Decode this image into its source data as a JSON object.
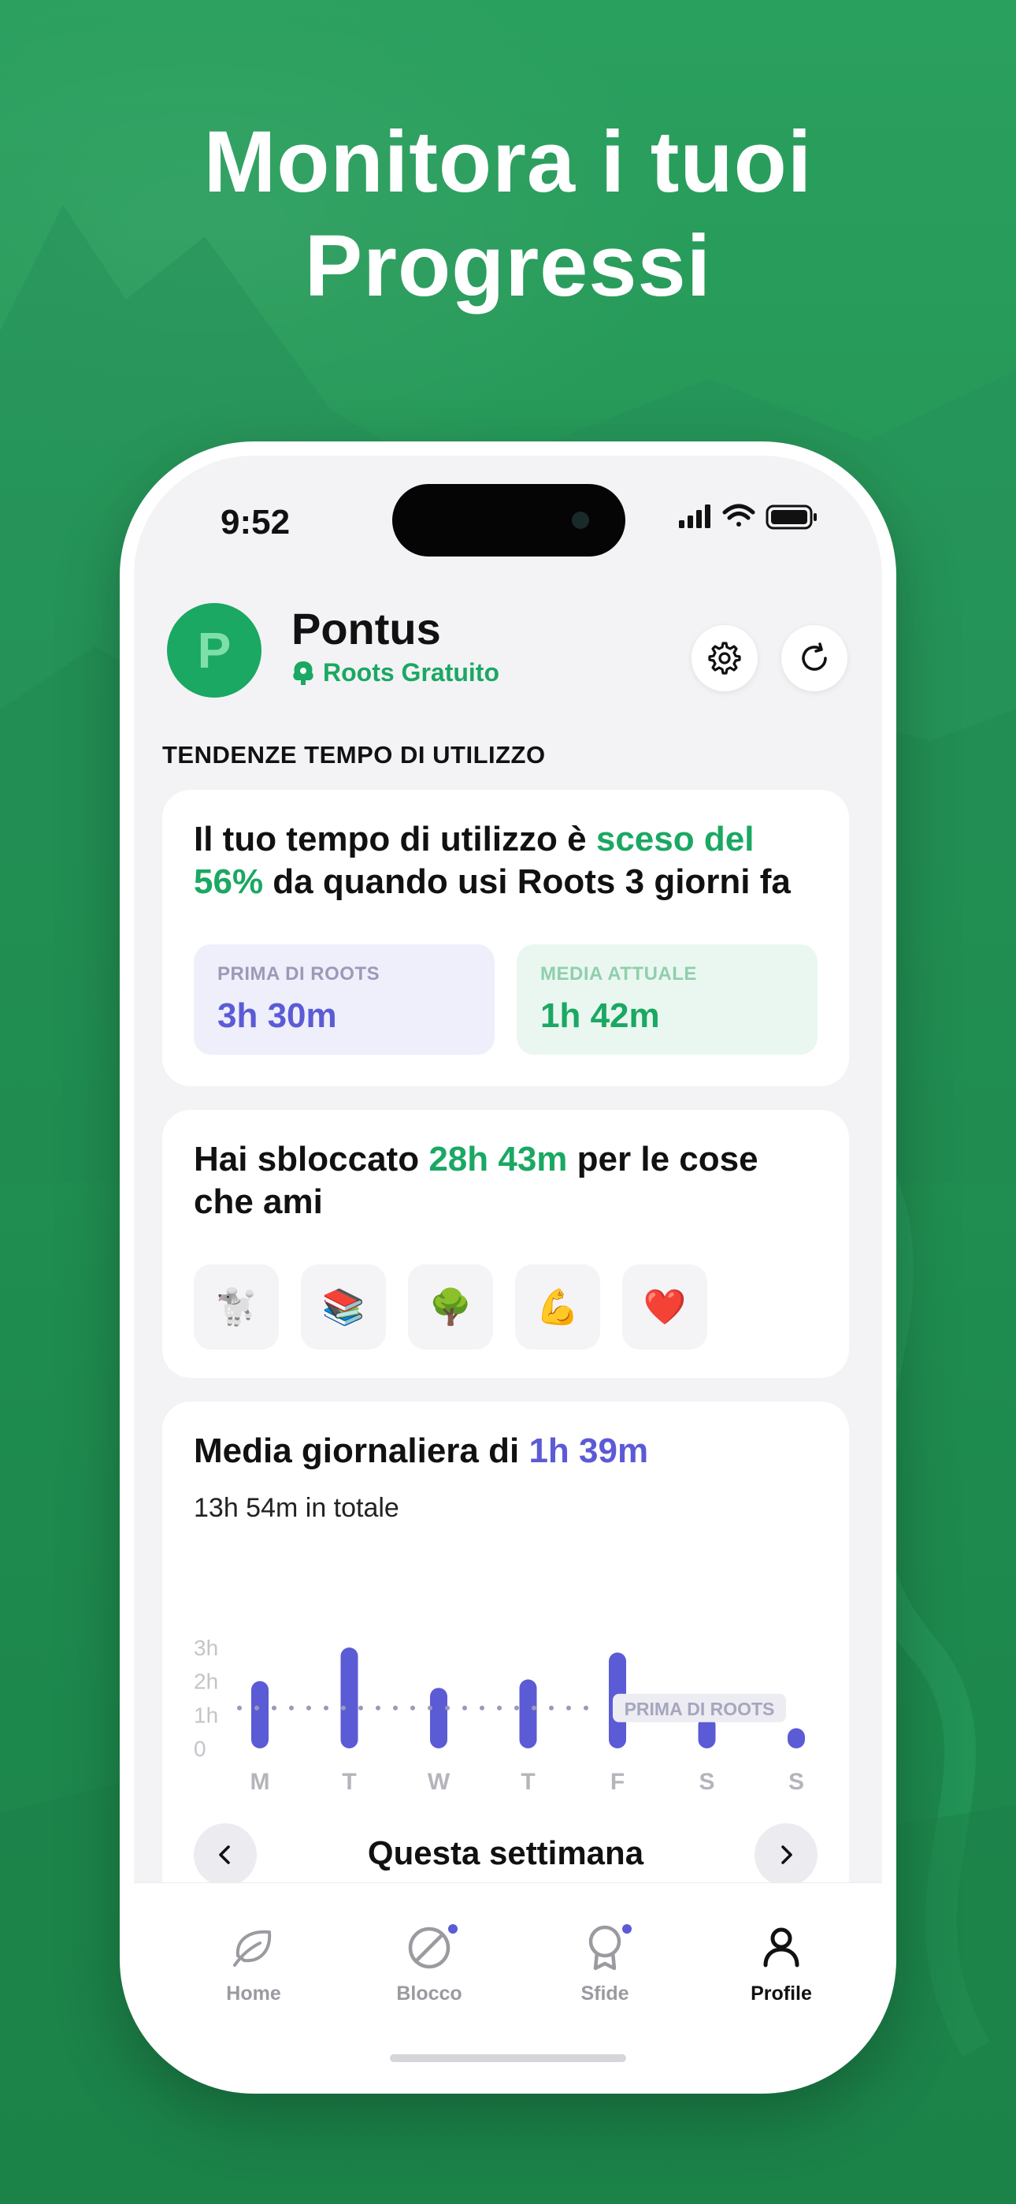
{
  "headline": {
    "line1": "Monitora i tuoi",
    "line2": "Progressi"
  },
  "status_bar": {
    "time": "9:52"
  },
  "profile": {
    "avatar_letter": "P",
    "name": "Pontus",
    "plan": "Roots Gratuito"
  },
  "section_label": "TENDENZE TEMPO DI UTILIZZO",
  "trend_card": {
    "text_before": "Il tuo tempo di utilizzo è ",
    "highlight": "sceso del 56%",
    "text_after": " da quando usi Roots 3 giorni fa",
    "before": {
      "label": "PRIMA DI ROOTS",
      "value": "3h 30m"
    },
    "current": {
      "label": "MEDIA ATTUALE",
      "value": "1h 42m"
    }
  },
  "unlocked_card": {
    "text_before": "Hai sbloccato ",
    "highlight": "28h 43m",
    "text_after": " per le cose che ami",
    "hobbies": [
      {
        "icon": "poodle-icon",
        "glyph": "🐩"
      },
      {
        "icon": "books-icon",
        "glyph": "📚"
      },
      {
        "icon": "tree-icon",
        "glyph": "🌳"
      },
      {
        "icon": "flexed-biceps-icon",
        "glyph": "💪"
      },
      {
        "icon": "heart-icon",
        "glyph": "❤️"
      }
    ]
  },
  "daily_card": {
    "text_before": "Media giornaliera di ",
    "highlight": "1h 39m",
    "total": "13h 54m in totale",
    "week_label": "Questa settimana"
  },
  "chart_data": {
    "type": "bar",
    "categories": [
      "M",
      "T",
      "W",
      "T",
      "F",
      "S",
      "S"
    ],
    "values": [
      2.0,
      3.0,
      1.8,
      2.05,
      2.85,
      0.95,
      0.6
    ],
    "unit": "h",
    "ylim": [
      0,
      3
    ],
    "y_ticks": [
      "0",
      "1h",
      "2h",
      "3h"
    ],
    "reference_line": {
      "label": "PRIMA DI ROOTS",
      "value": 1.2
    },
    "bar_color": "#5b5bd6",
    "grid": false
  },
  "tabs": [
    {
      "label": "Home",
      "icon": "leaf-icon",
      "active": false,
      "badge": false
    },
    {
      "label": "Blocco",
      "icon": "block-icon",
      "active": false,
      "badge": true
    },
    {
      "label": "Sfide",
      "icon": "medal-icon",
      "active": false,
      "badge": true
    },
    {
      "label": "Profile",
      "icon": "person-icon",
      "active": true,
      "badge": false
    }
  ],
  "colors": {
    "background": "#2b9a5c",
    "accent_green": "#1aa862",
    "accent_purple": "#5b5bd6"
  }
}
